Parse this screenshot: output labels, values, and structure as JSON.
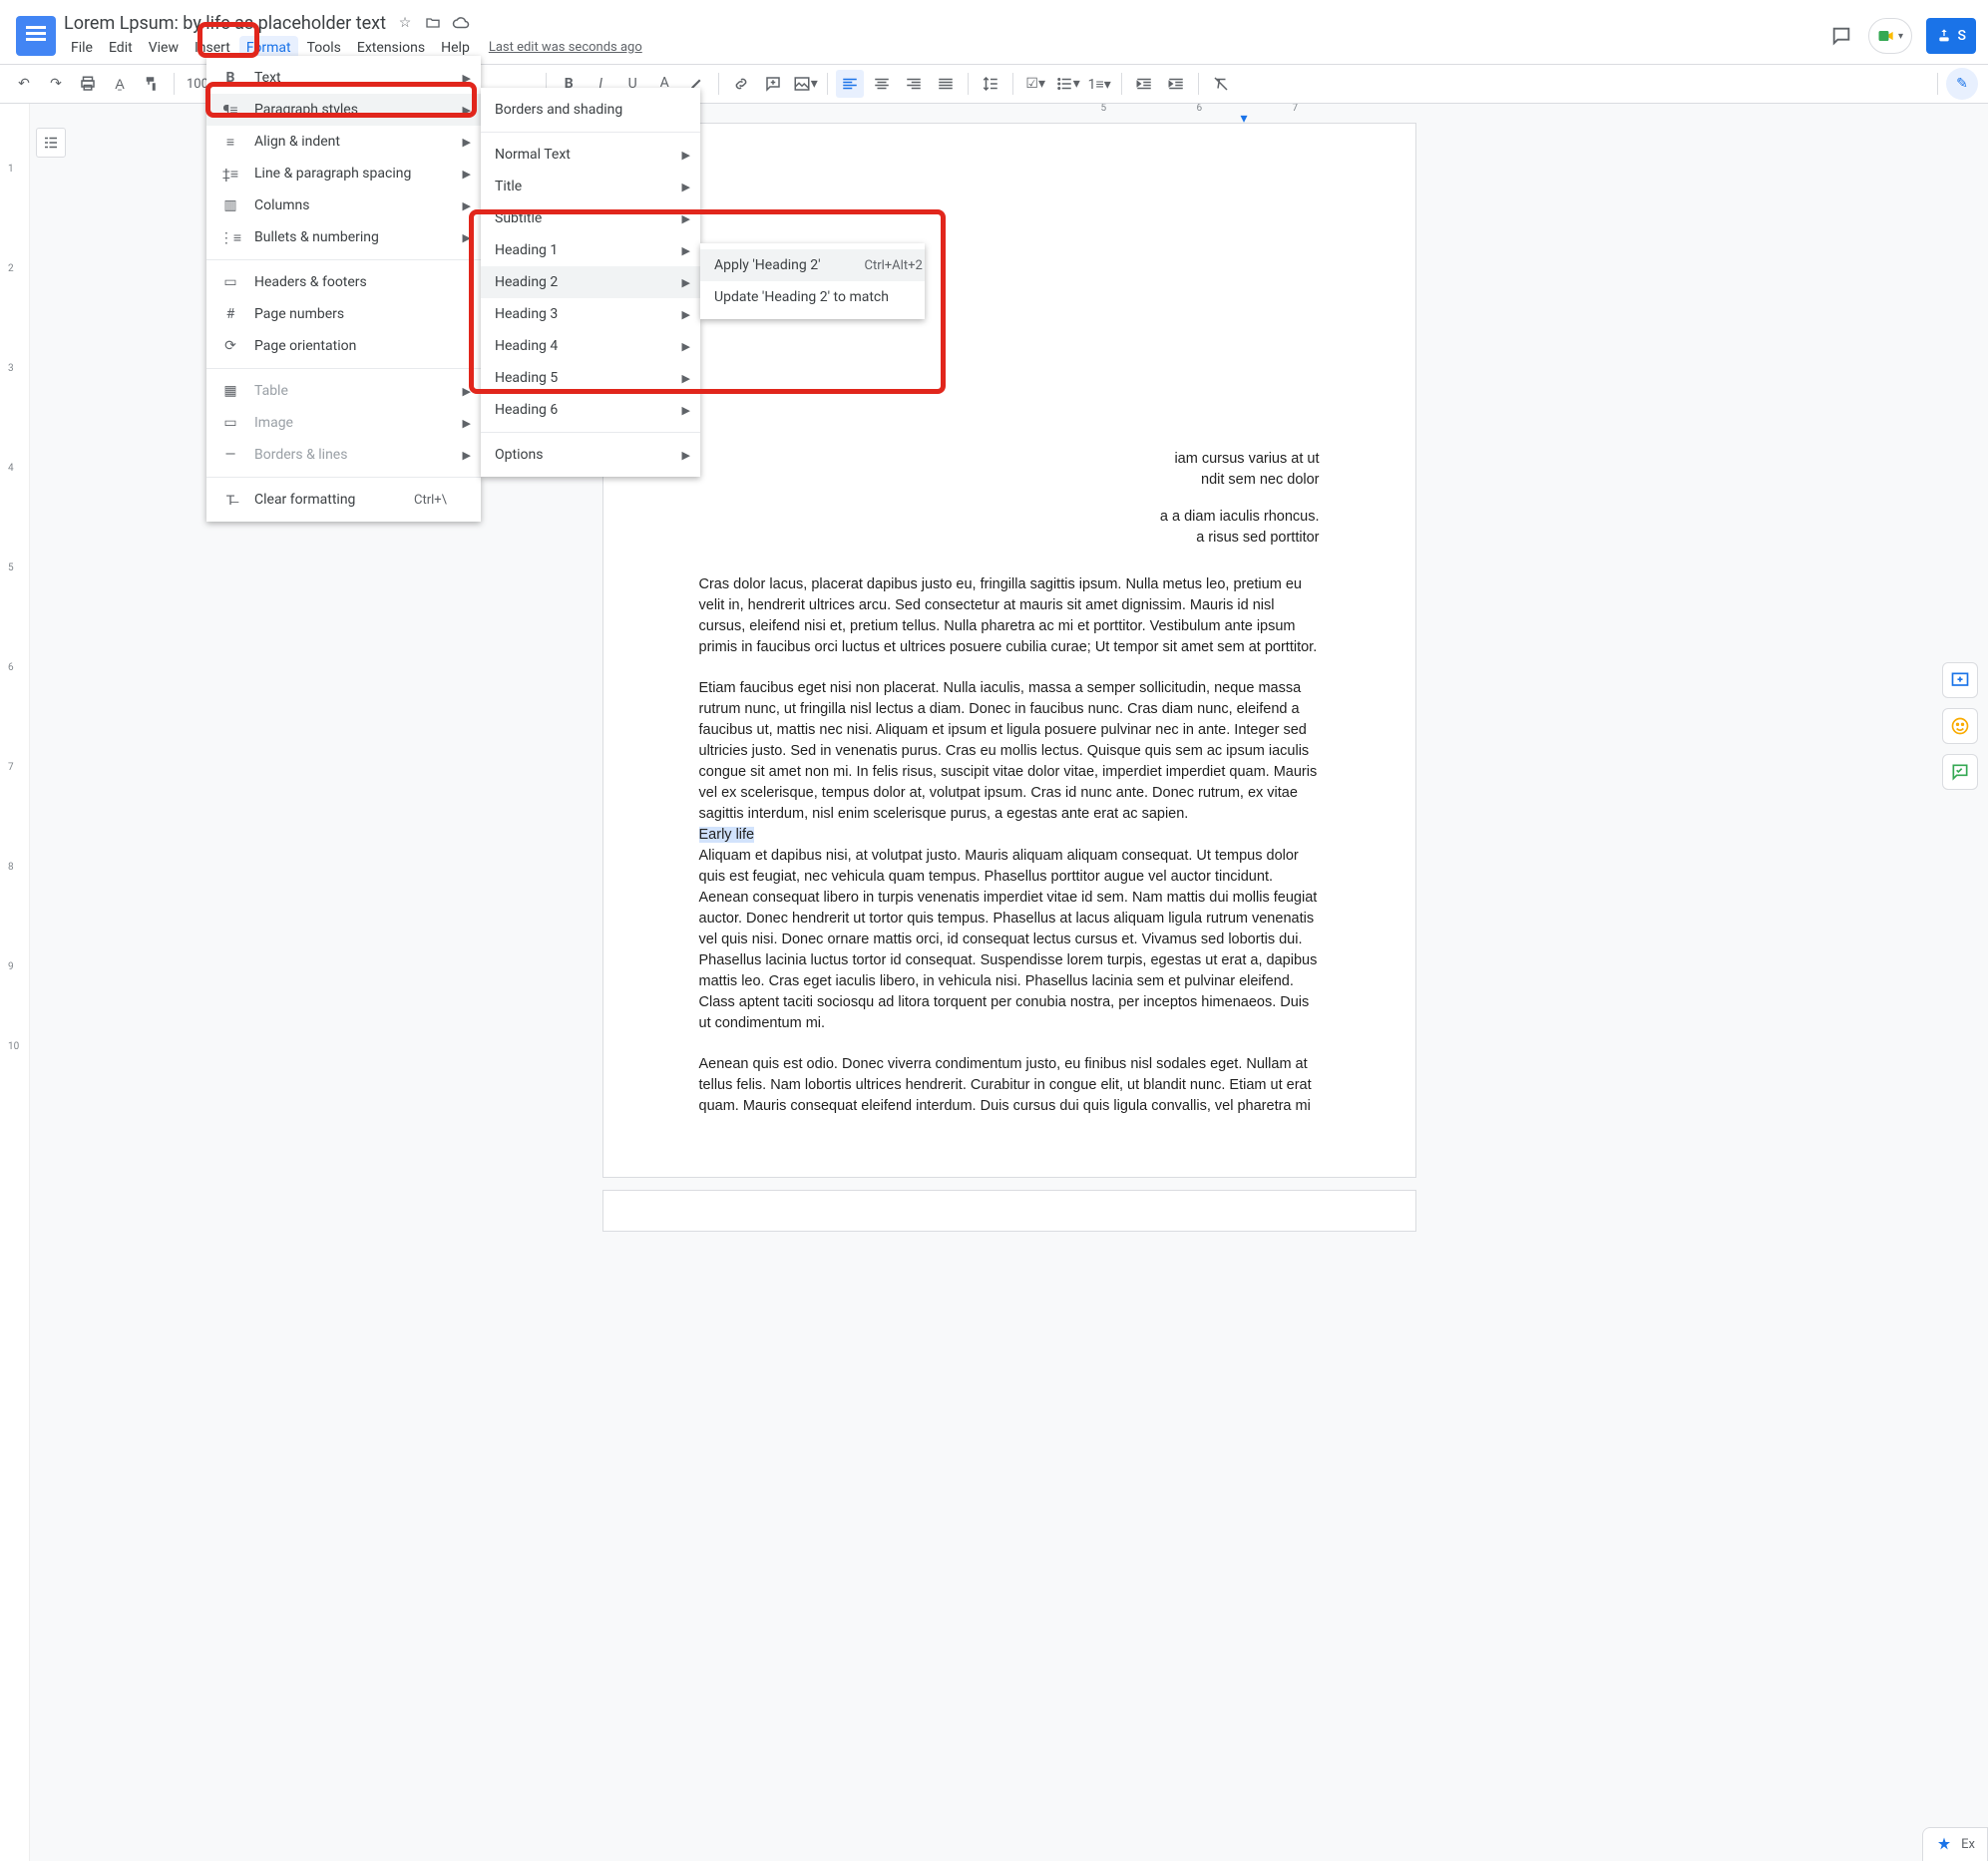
{
  "doc": {
    "title": "Lorem Lpsum: by life as placeholder text",
    "last_edit": "Last edit was seconds ago"
  },
  "menus": {
    "file": "File",
    "edit": "Edit",
    "view": "View",
    "insert": "Insert",
    "format": "Format",
    "tools": "Tools",
    "extensions": "Extensions",
    "help": "Help"
  },
  "toolbar": {
    "zoom": "100%"
  },
  "share": {
    "label": "S"
  },
  "format_menu": {
    "text": "Text",
    "paragraph": "Paragraph styles",
    "align": "Align & indent",
    "spacing": "Line & paragraph spacing",
    "columns": "Columns",
    "bullets": "Bullets & numbering",
    "headers": "Headers & footers",
    "pagenum": "Page numbers",
    "orient": "Page orientation",
    "table": "Table",
    "image": "Image",
    "borders": "Borders & lines",
    "clear": "Clear formatting",
    "clear_sc": "Ctrl+\\"
  },
  "para_menu": {
    "bshade": "Borders and shading",
    "normal": "Normal Text",
    "title": "Title",
    "subtitle": "Subtitle",
    "h1": "Heading 1",
    "h2": "Heading 2",
    "h3": "Heading 3",
    "h4": "Heading 4",
    "h5": "Heading 5",
    "h6": "Heading 6",
    "options": "Options"
  },
  "apply_menu": {
    "apply": "Apply 'Heading 2'",
    "apply_sc": "Ctrl+Alt+2",
    "update": "Update 'Heading 2' to match"
  },
  "hruler": [
    "5",
    "6",
    "7"
  ],
  "vruler": [
    "1",
    "2",
    "3",
    "4",
    "5",
    "6",
    "7",
    "8",
    "9",
    "10"
  ],
  "page": {
    "p1": "iam cursus varius at ut",
    "p1b": "ndit sem nec dolor",
    "p1d": "a a diam iaculis rhoncus.",
    "p1e": "a risus sed porttitor",
    "p2": "Cras dolor lacus, placerat dapibus justo eu, fringilla sagittis ipsum. Nulla metus leo, pretium eu velit in, hendrerit ultrices arcu. Sed consectetur at mauris sit amet dignissim. Mauris id nisl cursus, eleifend nisi et, pretium tellus. Nulla pharetra ac mi et porttitor. Vestibulum ante ipsum primis in faucibus orci luctus et ultrices posuere cubilia curae; Ut tempor sit amet sem at porttitor.",
    "p3": "Etiam faucibus eget nisi non placerat. Nulla iaculis, massa a semper sollicitudin, neque massa rutrum nunc, ut fringilla nisl lectus a diam. Donec in faucibus nunc. Cras diam nunc, eleifend a faucibus ut, mattis nec nisi. Aliquam et ipsum et ligula posuere pulvinar nec in ante. Integer sed ultricies justo. Sed in venenatis purus. Cras eu mollis lectus. Quisque quis sem ac ipsum iaculis congue sit amet non mi. In felis risus, suscipit vitae dolor vitae, imperdiet imperdiet quam. Mauris vel ex scelerisque, tempus dolor at, volutpat ipsum. Cras id nunc ante. Donec rutrum, ex vitae sagittis interdum, nisl enim scelerisque purus, a egestas ante erat ac sapien.",
    "early": "Early life",
    "p4": "Aliquam et dapibus nisi, at volutpat justo. Mauris aliquam aliquam consequat. Ut tempus dolor quis est feugiat, nec vehicula quam tempus. Phasellus porttitor augue vel auctor tincidunt. Aenean consequat libero in turpis venenatis imperdiet vitae id sem. Nam mattis dui mollis feugiat auctor. Donec hendrerit ut tortor quis tempus. Phasellus at lacus aliquam ligula rutrum venenatis vel quis nisi. Donec ornare mattis orci, id consequat lectus cursus et. Vivamus sed lobortis dui. Phasellus lacinia luctus tortor id consequat. Suspendisse lorem turpis, egestas ut erat a, dapibus mattis leo. Cras eget iaculis libero, in vehicula nisi. Phasellus lacinia sem et pulvinar eleifend. Class aptent taciti sociosqu ad litora torquent per conubia nostra, per inceptos himenaeos. Duis ut condimentum mi.",
    "p5": "Aenean quis est odio. Donec viverra condimentum justo, eu finibus nisl sodales eget. Nullam at tellus felis. Nam lobortis ultrices hendrerit. Curabitur in congue elit, ut blandit nunc. Etiam ut erat quam. Mauris consequat eleifend interdum. Duis cursus dui quis ligula convallis, vel pharetra mi"
  },
  "explore": "Ex"
}
